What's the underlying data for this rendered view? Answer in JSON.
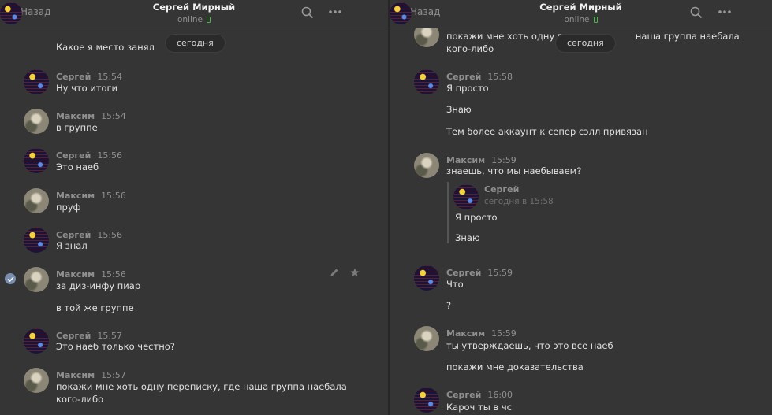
{
  "header": {
    "back_label": "Назад",
    "contact_name": "Сергей Мирный",
    "status": "online"
  },
  "date_separator": "сегодня",
  "left_pane": {
    "partial_top_line": "Какое я место занял",
    "messages": [
      {
        "author": "Сергей",
        "time": "15:54",
        "lines": [
          "Ну что итоги"
        ]
      },
      {
        "author": "Максим",
        "time": "15:54",
        "lines": [
          "в группе"
        ]
      },
      {
        "author": "Сергей",
        "time": "15:56",
        "lines": [
          "Это наеб"
        ]
      },
      {
        "author": "Максим",
        "time": "15:56",
        "lines": [
          "пруф"
        ]
      },
      {
        "author": "Сергей",
        "time": "15:56",
        "lines": [
          "Я знал"
        ]
      },
      {
        "author": "Максим",
        "time": "15:56",
        "lines": [
          "за диз-инфу пиар",
          "в той же группе"
        ]
      },
      {
        "author": "Сергей",
        "time": "15:57",
        "lines": [
          "Это наеб только честно?"
        ]
      },
      {
        "author": "Максим",
        "time": "15:57",
        "lines": [
          "покажи мне хоть одну переписку, где наша группа наебала",
          "кого-либо"
        ]
      }
    ]
  },
  "right_pane": {
    "partial_top_lines": [
      "покажи мне хоть одну пере",
      "наша группа наебала",
      "кого-либо"
    ],
    "messages": [
      {
        "author": "Сергей",
        "time": "15:58",
        "lines": [
          "Я просто",
          "Знаю",
          "Тем более аккаунт к сепер сэлл привязан"
        ]
      },
      {
        "author": "Максим",
        "time": "15:59",
        "lines": [
          "знаешь, что мы наебываем?"
        ]
      },
      {
        "author": "Сергей",
        "time": "15:59",
        "lines": [
          "Что",
          "?"
        ]
      },
      {
        "author": "Максим",
        "time": "15:59",
        "lines": [
          "ты утверждаешь, что это все наеб",
          "покажи мне доказательства"
        ]
      },
      {
        "author": "Сергей",
        "time": "16:00",
        "lines": [
          "Кароч ты в чс"
        ]
      }
    ],
    "forwarded": {
      "author": "Сергей",
      "time": "сегодня в 15:58",
      "lines": [
        "Я просто",
        "Знаю"
      ]
    }
  },
  "icons": {
    "back": "chevron-left-icon",
    "search": "search-icon",
    "more": "more-horizontal-icon",
    "edit": "pencil-icon",
    "favorite": "star-icon",
    "selected": "check-icon"
  }
}
